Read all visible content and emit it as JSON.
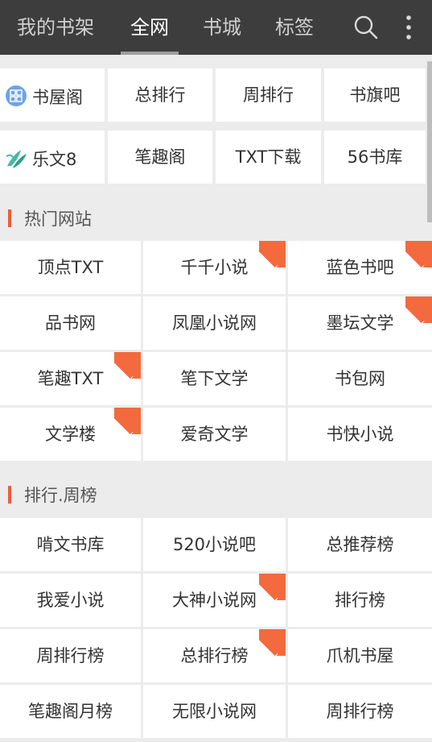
{
  "tabs": [
    "我的书架",
    "全网",
    "书城",
    "标签"
  ],
  "active_tab": 1,
  "sites_row1": [
    "书屋阁",
    "总排行",
    "周排行",
    "书旗吧"
  ],
  "sites_row2": [
    "乐文8",
    "笔趣阁",
    "TXT下载",
    "56书库"
  ],
  "hot_section": {
    "title": "热门网站",
    "items": [
      {
        "label": "顶点TXT",
        "hot": false
      },
      {
        "label": "千千小说",
        "hot": true
      },
      {
        "label": "蓝色书吧",
        "hot": true
      },
      {
        "label": "品书网",
        "hot": false
      },
      {
        "label": "凤凰小说网",
        "hot": false
      },
      {
        "label": "墨坛文学",
        "hot": true
      },
      {
        "label": "笔趣TXT",
        "hot": true
      },
      {
        "label": "笔下文学",
        "hot": false
      },
      {
        "label": "书包网",
        "hot": false
      },
      {
        "label": "文学楼",
        "hot": true
      },
      {
        "label": "爱奇文学",
        "hot": false
      },
      {
        "label": "书快小说",
        "hot": false
      }
    ]
  },
  "rank_section": {
    "title": "排行.周榜",
    "items": [
      {
        "label": "啃文书库",
        "hot": false
      },
      {
        "label": "520小说吧",
        "hot": false
      },
      {
        "label": "总推荐榜",
        "hot": false
      },
      {
        "label": "我爱小说",
        "hot": false
      },
      {
        "label": "大神小说网",
        "hot": true
      },
      {
        "label": "排行榜",
        "hot": false
      },
      {
        "label": "周排行榜",
        "hot": false
      },
      {
        "label": "总排行榜",
        "hot": true
      },
      {
        "label": "爪机书屋",
        "hot": false
      },
      {
        "label": "笔趣阁月榜",
        "hot": false
      },
      {
        "label": "无限小说网",
        "hot": false
      },
      {
        "label": "周排行榜",
        "hot": false
      }
    ]
  },
  "hot_badge": "HOT",
  "colors": {
    "topbar": "#3d3d3d",
    "accent": "#ee5c3a",
    "hot": "#f26a3d"
  },
  "icons": [
    "search-icon",
    "more-vert-icon",
    "shuwuge-logo-icon",
    "lewen-logo-icon"
  ]
}
